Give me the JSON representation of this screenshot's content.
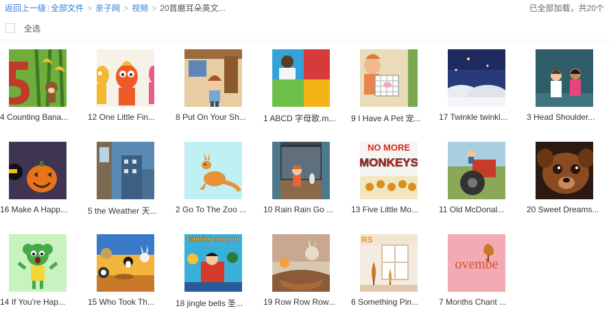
{
  "breadcrumb": {
    "back": "返回上一级",
    "sep_bar": "|",
    "all_files": "全部文件",
    "sep": ">",
    "level1": "亲子网",
    "level2": "视频",
    "current": "20首磨耳朵英文..."
  },
  "status": "已全部加载，共20个",
  "select_all": "全选",
  "items": [
    {
      "caption": "4 Counting Bana...",
      "icon": "counting-bananas-thumbnail"
    },
    {
      "caption": "12 One Little Fin...",
      "icon": "one-little-finger-thumbnail"
    },
    {
      "caption": "8 Put On Your Sh...",
      "icon": "put-on-your-shoes-thumbnail"
    },
    {
      "caption": "1 ABCD 字母歌.m...",
      "icon": "abcd-song-thumbnail"
    },
    {
      "caption": "9 I Have A Pet 宠...",
      "icon": "i-have-a-pet-thumbnail"
    },
    {
      "caption": "17 Twinkle twinkl...",
      "icon": "twinkle-twinkle-thumbnail"
    },
    {
      "caption": "3 Head Shoulder...",
      "icon": "head-shoulders-thumbnail"
    },
    {
      "caption": "16 Make A Happ...",
      "icon": "make-a-happy-face-thumbnail"
    },
    {
      "caption": "5 the Weather 天...",
      "icon": "the-weather-thumbnail"
    },
    {
      "caption": "2 Go To The Zoo ...",
      "icon": "go-to-the-zoo-thumbnail"
    },
    {
      "caption": "10 Rain Rain Go ...",
      "icon": "rain-rain-go-away-thumbnail"
    },
    {
      "caption": "13 Five Little Mo...",
      "icon": "five-little-monkeys-thumbnail"
    },
    {
      "caption": "11 Old McDonal...",
      "icon": "old-mcdonald-thumbnail"
    },
    {
      "caption": "20 Sweet Dreams...",
      "icon": "sweet-dreams-thumbnail"
    },
    {
      "caption": "14 If You're Hap...",
      "icon": "if-youre-happy-thumbnail"
    },
    {
      "caption": "15 Who Took Th...",
      "icon": "who-took-the-cookie-thumbnail"
    },
    {
      "caption": "18 jingle bells 圣...",
      "icon": "jingle-bells-thumbnail"
    },
    {
      "caption": "19 Row Row Row...",
      "icon": "row-row-row-thumbnail"
    },
    {
      "caption": "6 Something Pin...",
      "icon": "something-pink-thumbnail"
    },
    {
      "caption": "7 Months Chant ...",
      "icon": "months-chant-thumbnail"
    }
  ],
  "thumb_text": {
    "no_more": "NO MORE",
    "monkeys": "MONKEYS",
    "neighing": "eighing song fo",
    "ovembe": "ovembe",
    "rs": "RS"
  }
}
